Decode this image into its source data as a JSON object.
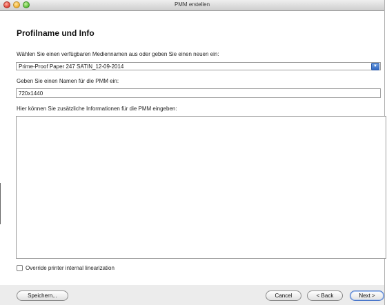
{
  "window": {
    "title": "PMM erstellen"
  },
  "page": {
    "heading": "Profilname und Info",
    "media_label": "Wählen Sie einen verfügbaren Mediennamen aus oder geben Sie einen neuen ein:",
    "media_value": "Prime-Proof Paper 247 SATIN_12-09-2014",
    "name_label": "Geben Sie einen Namen für die PMM ein:",
    "name_value": "720x1440",
    "info_label": "Hier können Sie zusätzliche Informationen für die PMM eingeben:",
    "info_value": "",
    "override_label": "Override printer internal linearization",
    "override_checked": false
  },
  "footer": {
    "save_label": "Speichern...",
    "cancel_label": "Cancel",
    "back_label": "< Back",
    "next_label": "Next >"
  },
  "icons": {
    "dropdown": "chevron-down-icon"
  }
}
